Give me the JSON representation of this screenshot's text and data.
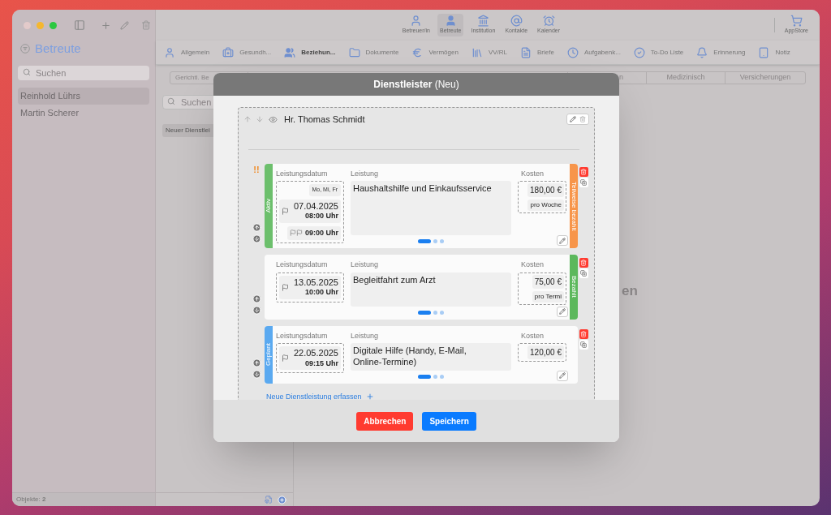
{
  "sidebar": {
    "title": "Betreute",
    "search": {
      "placeholder": "Suchen"
    },
    "items": [
      {
        "label": "Reinhold Lührs",
        "selected": true
      },
      {
        "label": "Martin Scherer",
        "selected": false
      }
    ],
    "status": "Objekte: **2**"
  },
  "toolbar": {
    "items": [
      {
        "label": "Betreuer/in",
        "selected": false
      },
      {
        "label": "Betreute",
        "selected": true
      },
      {
        "label": "Institution",
        "selected": false
      },
      {
        "label": "Kontakte",
        "selected": false
      },
      {
        "label": "Kalender",
        "selected": false
      }
    ],
    "store": "AppStore"
  },
  "section_tabs": [
    {
      "label": "Allgemein",
      "selected": false
    },
    {
      "label": "Gesundh...",
      "selected": false
    },
    {
      "label": "Beziehun...",
      "selected": true
    },
    {
      "label": "Dokumente",
      "selected": false
    },
    {
      "label": "Vermögen",
      "selected": false
    },
    {
      "label": "VV/RL",
      "selected": false
    },
    {
      "label": "Briefe",
      "selected": false
    },
    {
      "label": "Aufgabenk...",
      "selected": false
    },
    {
      "label": "To-Do Liste",
      "selected": false
    },
    {
      "label": "Erinnerung",
      "selected": false
    },
    {
      "label": "Notiz",
      "selected": false
    }
  ],
  "segments": [
    {
      "label": "Gerichtl. Be"
    },
    {
      "label": "n"
    },
    {
      "label": "Medizinisch"
    },
    {
      "label": "Versicherungen"
    }
  ],
  "list_panel": {
    "search": {
      "placeholder": "Suchen"
    },
    "items": [
      {
        "label": "Neuer Dienstlei",
        "selected": true
      }
    ]
  },
  "detail_text": "en",
  "dialog": {
    "title": "**Dienstleister** (Neu)",
    "provider": {
      "name": "Hr. Thomas Schmidt"
    },
    "services": [
      {
        "alert": "!!",
        "left_status": {
          "label": "Aktiv",
          "color": "#6cbf6c"
        },
        "right_status": {
          "label": "Teilweise bezahlt",
          "color": "#f7954a"
        },
        "date_label": "Leistungsdatum",
        "weekdays": "Mo, Mi, Fr",
        "start_date": "07.04.2025",
        "start_time": "08:00 Uhr",
        "end_time": "09:00 Uhr",
        "service_label": "Leistung",
        "service": "Haushaltshilfe und Einkaufsservice",
        "cost_label": "Kosten",
        "amount": "180,00 €",
        "period": "pro Woche",
        "pages": [
          {
            "selected": true
          },
          {
            "selected": false
          },
          {
            "selected": false
          }
        ]
      },
      {
        "right_status": {
          "label": "Bezahlt",
          "color": "#5cb85c"
        },
        "date_label": "Leistungsdatum",
        "start_date": "13.05.2025",
        "start_time": "10:00 Uhr",
        "service_label": "Leistung",
        "service": "Begleitfahrt zum Arzt",
        "cost_label": "Kosten",
        "amount": "75,00 €",
        "period": "pro Termi",
        "pages": [
          {
            "selected": true
          },
          {
            "selected": false
          },
          {
            "selected": false
          }
        ]
      },
      {
        "left_status": {
          "label": "Geplant",
          "color": "#5aa9f0"
        },
        "date_label": "Leistungsdatum",
        "start_date": "22.05.2025",
        "start_time": "09:15 Uhr",
        "service_label": "Leistung",
        "service": "Digitale Hilfe (Handy, E-Mail, Online-Termine)",
        "cost_label": "Kosten",
        "amount": "120,00 €",
        "pages": [
          {
            "selected": true
          },
          {
            "selected": false
          },
          {
            "selected": false
          }
        ]
      }
    ],
    "add_link": "Neue Dienstleistung erfassen",
    "buttons": [
      {
        "label": "Abbrechen",
        "kind": "cancel"
      },
      {
        "label": "Speichern",
        "kind": "save"
      }
    ]
  }
}
